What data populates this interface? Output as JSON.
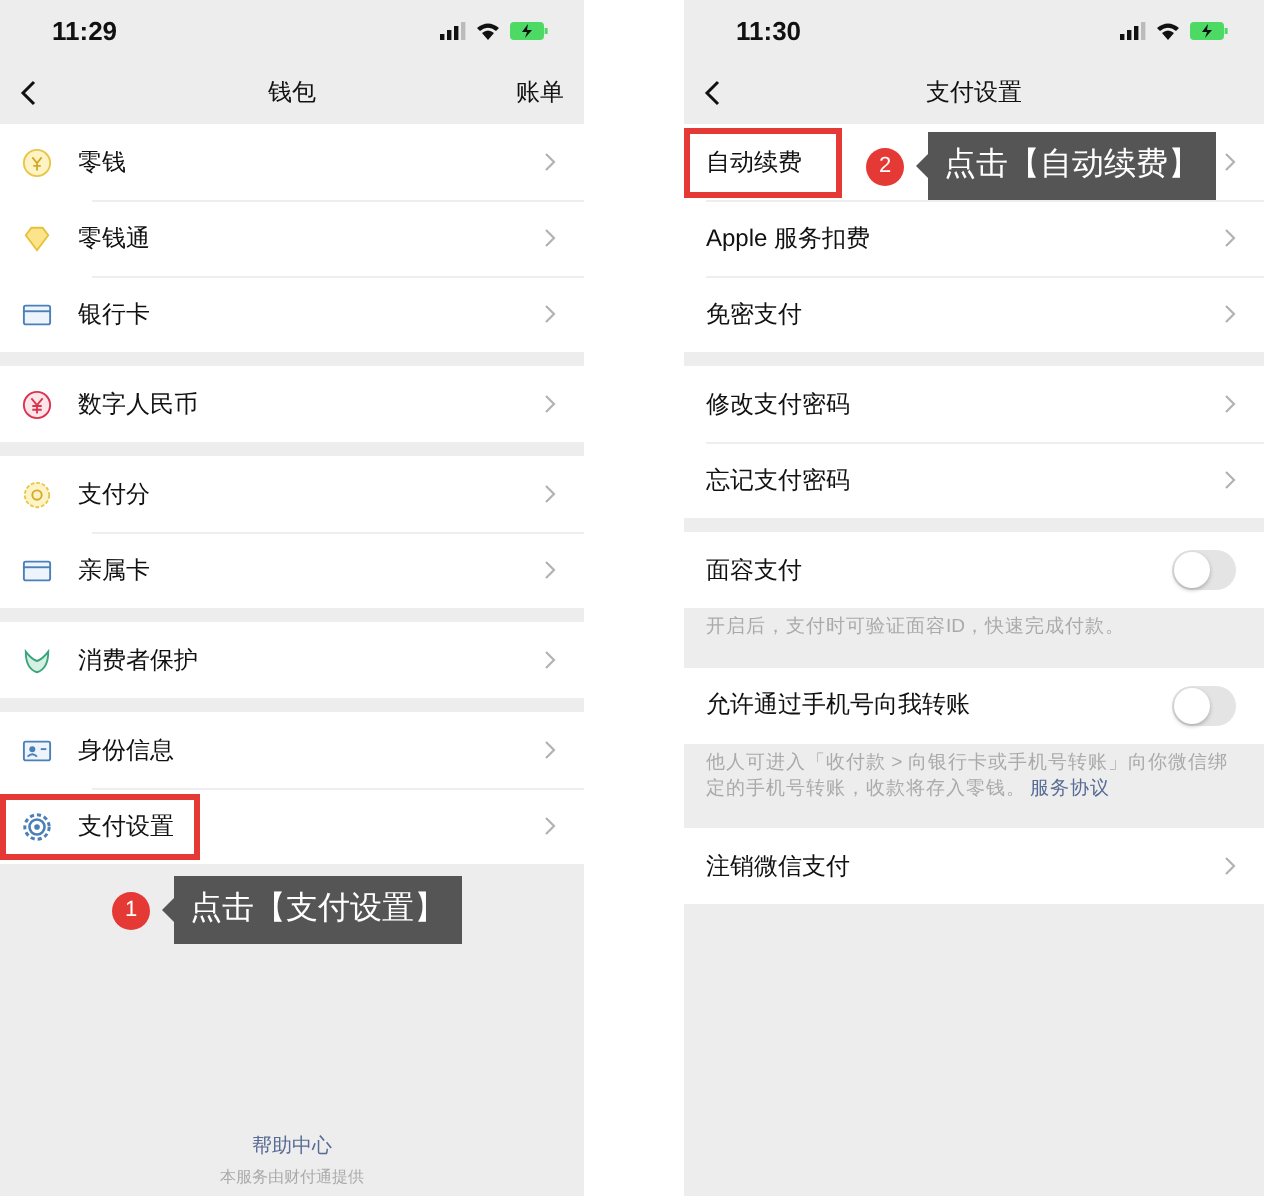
{
  "phones": [
    {
      "kind": "wallet",
      "status_bar": {
        "time": "11:29"
      },
      "nav": {
        "title": "钱包",
        "action": "账单"
      },
      "groups": [
        {
          "rows": [
            {
              "kind": "link",
              "label": "零钱",
              "highlight": false
            },
            {
              "kind": "link",
              "label": "零钱通",
              "highlight": false
            },
            {
              "kind": "link",
              "label": "银行卡",
              "highlight": false
            }
          ]
        },
        {
          "rows": [
            {
              "kind": "link",
              "label": "数字人民币",
              "highlight": false
            }
          ]
        },
        {
          "rows": [
            {
              "kind": "link",
              "label": "支付分",
              "highlight": false
            },
            {
              "kind": "link",
              "label": "亲属卡",
              "highlight": false
            }
          ]
        },
        {
          "rows": [
            {
              "kind": "link",
              "label": "消费者保护",
              "highlight": false
            }
          ]
        },
        {
          "rows": [
            {
              "kind": "link",
              "label": "身份信息",
              "highlight": false
            },
            {
              "kind": "link",
              "label": "支付设置",
              "highlight": true
            }
          ]
        }
      ],
      "callout": {
        "number": "1",
        "text": "点击【支付设置】"
      },
      "footer": {
        "link": "帮助中心",
        "note": "本服务由财付通提供"
      }
    },
    {
      "kind": "settings",
      "status_bar": {
        "time": "11:30"
      },
      "nav": {
        "title": "支付设置"
      },
      "groups": [
        {
          "rows": [
            {
              "kind": "link",
              "label": "自动续费",
              "highlight": true
            },
            {
              "kind": "link",
              "label": "Apple 服务扣费",
              "highlight": false
            },
            {
              "kind": "link",
              "label": "免密支付",
              "highlight": false
            }
          ]
        },
        {
          "rows": [
            {
              "kind": "link",
              "label": "修改支付密码",
              "highlight": false
            },
            {
              "kind": "link",
              "label": "忘记支付密码",
              "highlight": false
            }
          ]
        },
        {
          "rows": [
            {
              "kind": "toggle",
              "label": "面容支付",
              "highlight": false,
              "on": false
            }
          ],
          "note": {
            "text": "开启后，支付时可验证面容ID，快速完成付款。"
          }
        },
        {
          "rows": [
            {
              "kind": "toggle",
              "label": "允许通过手机号向我转账",
              "highlight": false,
              "on": false
            }
          ],
          "note": {
            "text": "他人可进入「收付款 > 向银行卡或手机号转账」向你微信绑定的手机号转账，收款将存入零钱。",
            "link": "服务协议"
          }
        },
        {
          "rows": [
            {
              "kind": "link",
              "label": "注销微信支付",
              "highlight": false
            }
          ]
        }
      ],
      "callout": {
        "number": "2",
        "text": "点击【自动续费】"
      }
    }
  ]
}
